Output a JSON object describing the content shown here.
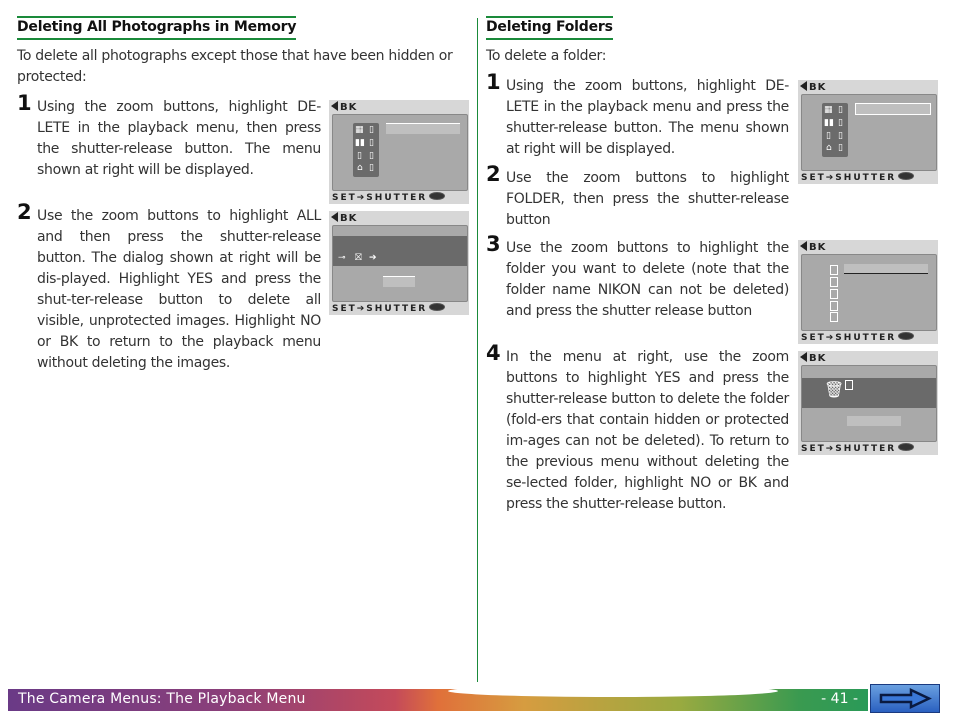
{
  "left": {
    "heading": "Deleting All Photographs in Memory",
    "intro": "To delete all photographs except those that have been hidden or protected:",
    "steps": [
      {
        "num": "1",
        "text": "Using the zoom buttons, highlight DE-LETE in the playback menu, then press the shutter-release button.  The menu shown at right will be displayed."
      },
      {
        "num": "2",
        "text": "Use the zoom buttons to highlight ALL and then press the shutter-release button. The dialog shown at right will be dis-played.  Highlight YES and press the shut-ter-release button to delete all visible, unprotected images.  Highlight NO or BK to return to the playback menu without deleting the images."
      }
    ]
  },
  "right": {
    "heading": "Deleting Folders",
    "intro": "To delete a folder:",
    "steps": [
      {
        "num": "1",
        "text": "Using the zoom buttons, highlight DE-LETE in the playback menu and press the shutter-release button.  The menu shown at right will be displayed."
      },
      {
        "num": "2",
        "text": "Use the zoom buttons to highlight FOLDER, then press the shutter-release button"
      },
      {
        "num": "3",
        "text": "Use the zoom buttons to highlight the folder you want to delete (note that the folder name NIKON can not be deleted) and press the shutter release button"
      },
      {
        "num": "4",
        "text": "In the menu at right, use the zoom buttons to highlight YES and press the shutter-release button to delete the folder (fold-ers that contain hidden or protected im-ages can not be deleted). To return to the previous menu without deleting the se-lected folder, highlight NO or BK  and press the shutter-release button."
      }
    ]
  },
  "screen": {
    "back_label": "BK",
    "footer_label": "SET➔SHUTTER"
  },
  "footer": {
    "section_title": "The Camera Menus: The Playback Menu",
    "page_number": "- 41 -"
  },
  "colors": {
    "accent_green": "#1a8a3a"
  }
}
